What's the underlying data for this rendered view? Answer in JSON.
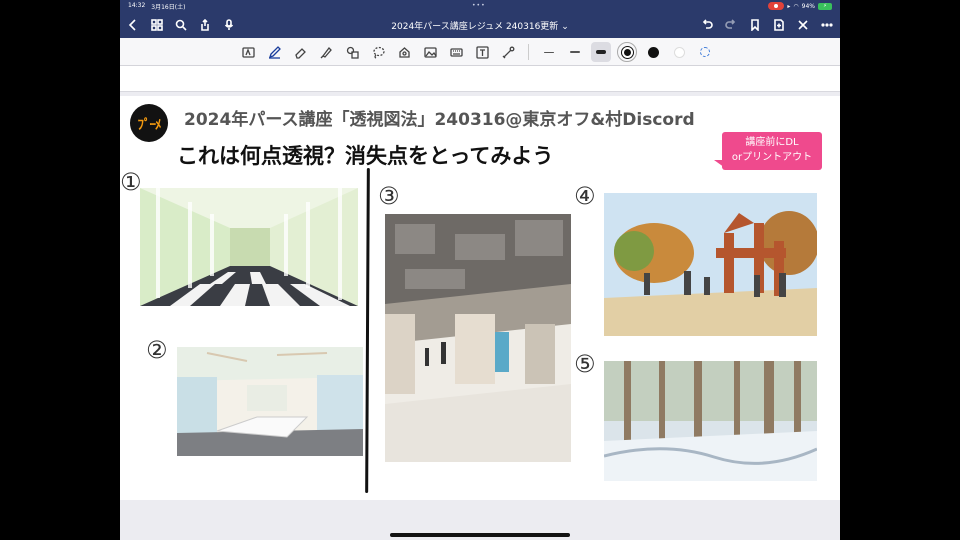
{
  "status_bar": {
    "time": "14:32",
    "date": "3月16日(土)",
    "dots": "•••",
    "battery_text": "94%"
  },
  "nav": {
    "title": "2024年パース講座レジュメ 240316更新",
    "title_chevron": "⌄"
  },
  "toolbar": {
    "tools": [
      "lasso-text-icon",
      "pen-icon",
      "eraser-icon",
      "highlighter-icon",
      "shapes-icon",
      "lasso-icon",
      "sticker-icon",
      "image-icon",
      "keyboard-icon",
      "textbox-icon",
      "laser-pointer-icon"
    ],
    "colors": [
      "#111111",
      "#111111",
      "#ffffff",
      "#3a78d8"
    ]
  },
  "slide": {
    "logo_text": "ﾌﾟｰﾒ",
    "header": "2024年パース講座「透視図法」240316@東京オフ&村Discord",
    "question": "これは何点透視？消失点をとってみよう",
    "callout_line1": "講座前にDL",
    "callout_line2": "orプリントアウト",
    "numbers": [
      "①",
      "②",
      "③",
      "④",
      "⑤"
    ]
  }
}
